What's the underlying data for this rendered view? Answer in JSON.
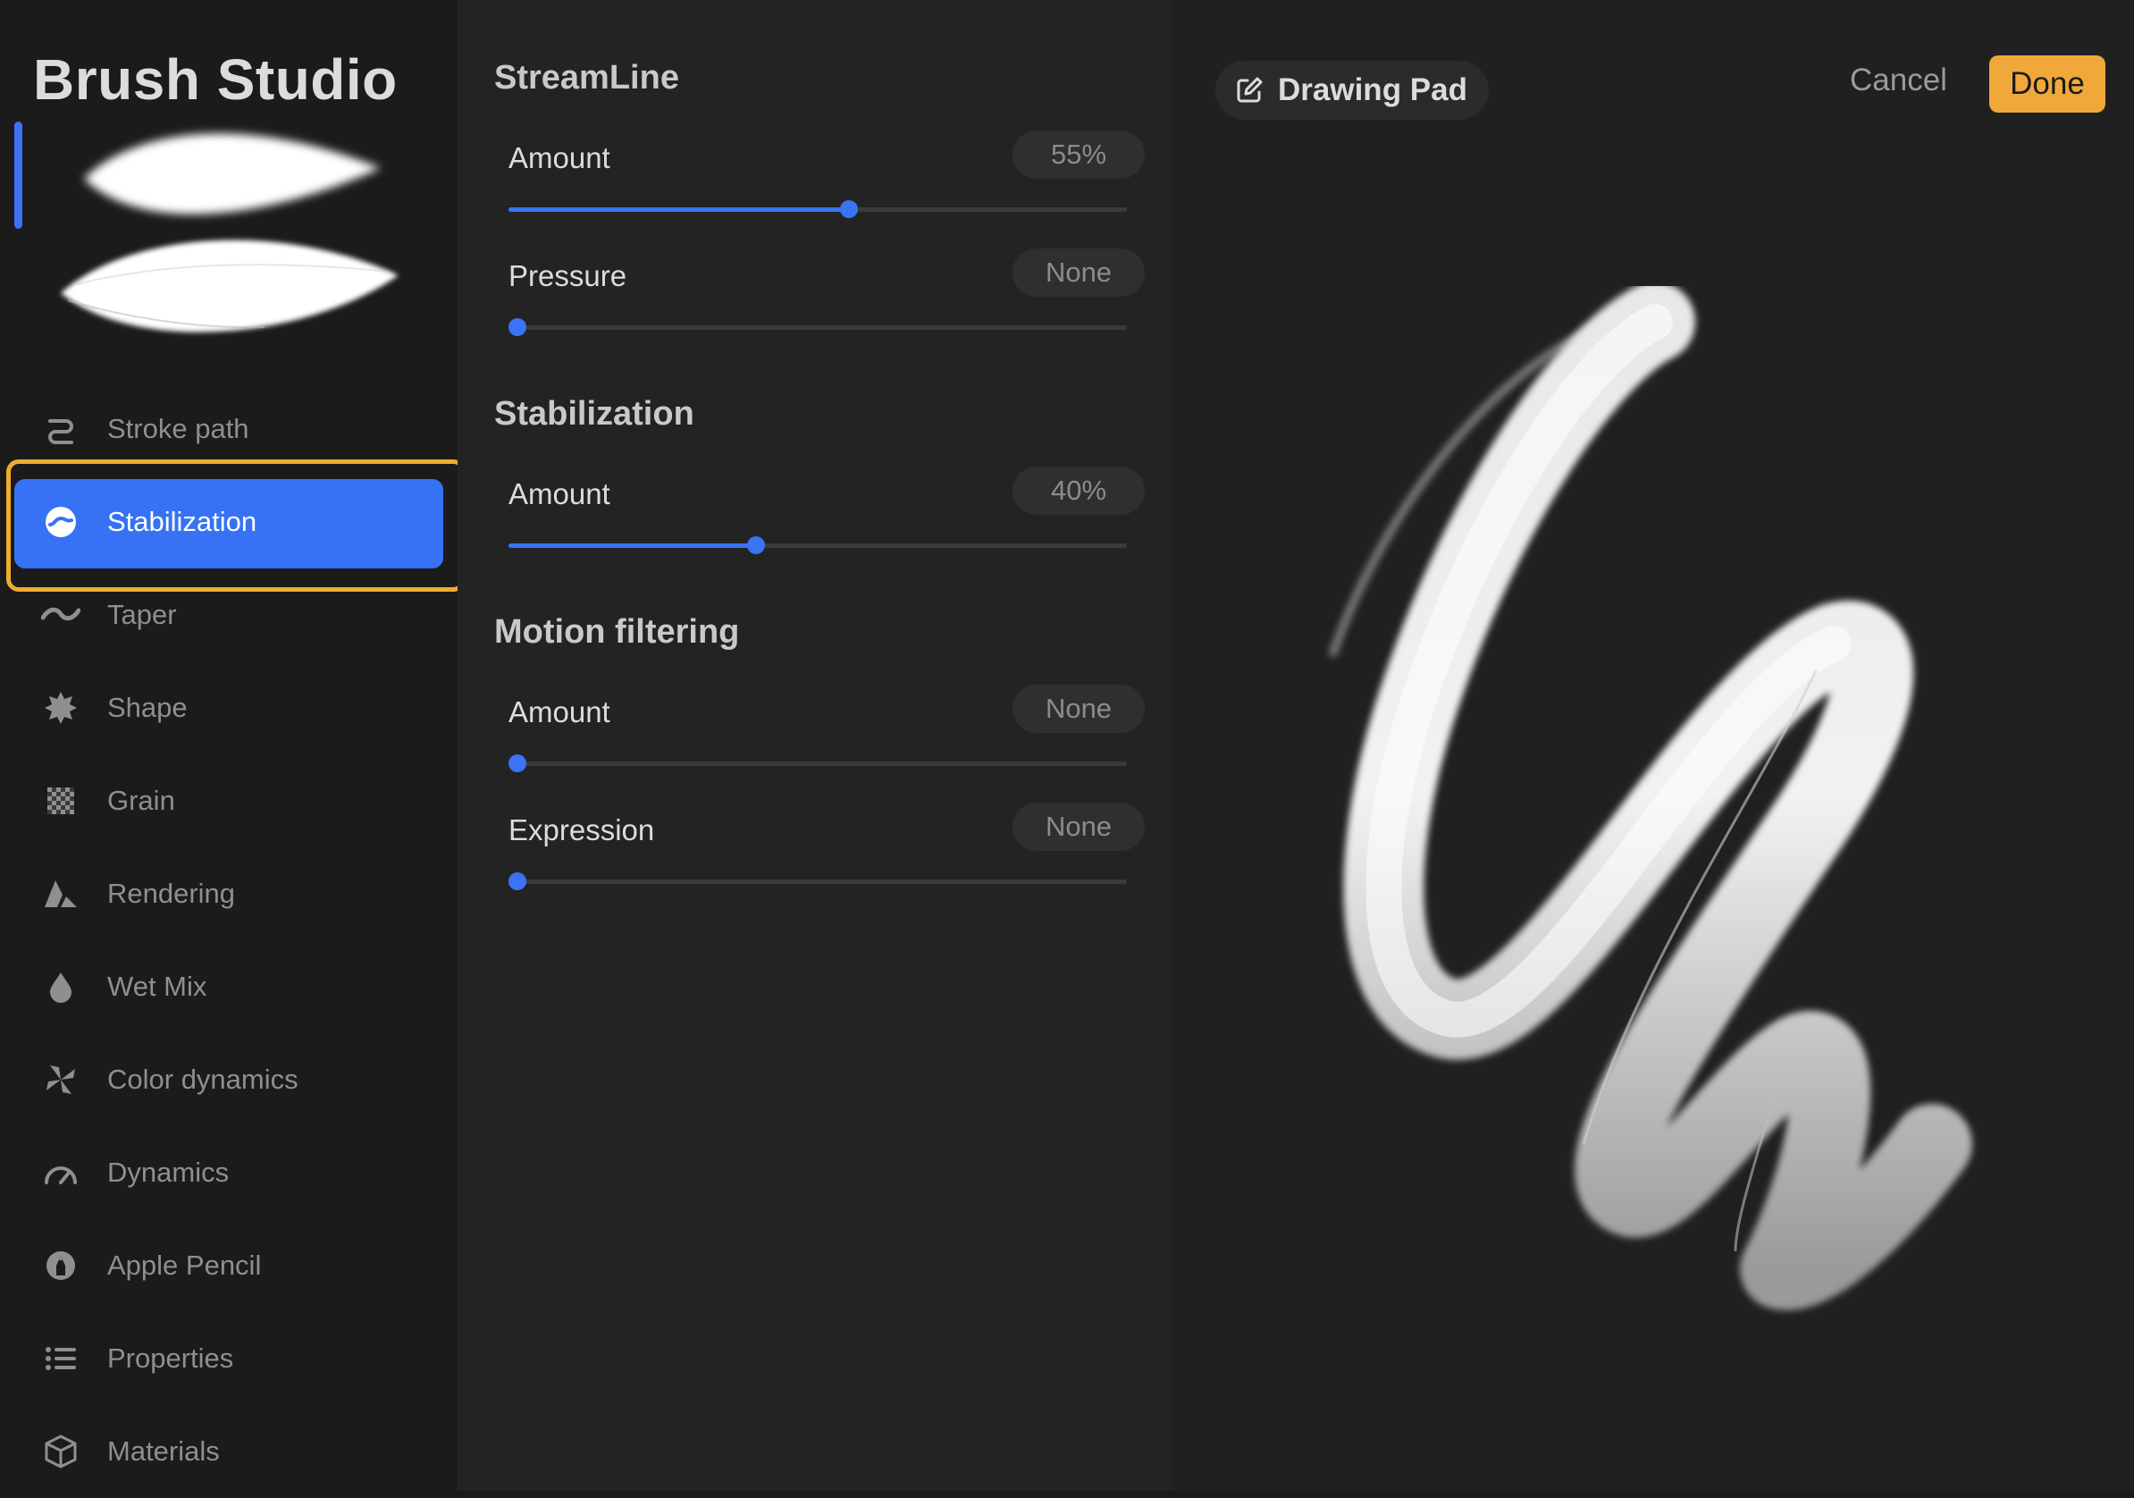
{
  "app": {
    "title": "Brush Studio"
  },
  "sidebar": {
    "items": [
      {
        "label": "Stroke path",
        "icon": "stroke-path-icon",
        "active": false
      },
      {
        "label": "Stabilization",
        "icon": "stabilization-icon",
        "active": true
      },
      {
        "label": "Taper",
        "icon": "taper-icon",
        "active": false
      },
      {
        "label": "Shape",
        "icon": "shape-icon",
        "active": false
      },
      {
        "label": "Grain",
        "icon": "grain-icon",
        "active": false
      },
      {
        "label": "Rendering",
        "icon": "rendering-icon",
        "active": false
      },
      {
        "label": "Wet Mix",
        "icon": "droplet-icon",
        "active": false
      },
      {
        "label": "Color dynamics",
        "icon": "color-dynamics-icon",
        "active": false
      },
      {
        "label": "Dynamics",
        "icon": "gauge-icon",
        "active": false
      },
      {
        "label": "Apple Pencil",
        "icon": "pencil-icon",
        "active": false
      },
      {
        "label": "Properties",
        "icon": "list-icon",
        "active": false
      },
      {
        "label": "Materials",
        "icon": "cube-icon",
        "active": false
      }
    ]
  },
  "settings": {
    "streamline": {
      "title": "StreamLine",
      "amount": {
        "label": "Amount",
        "value": "55%",
        "level": 0.55
      },
      "pressure": {
        "label": "Pressure",
        "value": "None",
        "level": 0
      }
    },
    "stabilization": {
      "title": "Stabilization",
      "amount": {
        "label": "Amount",
        "value": "40%",
        "level": 0.4
      }
    },
    "motion_filtering": {
      "title": "Motion filtering",
      "amount": {
        "label": "Amount",
        "value": "None",
        "level": 0
      },
      "expression": {
        "label": "Expression",
        "value": "None",
        "level": 0
      }
    }
  },
  "pad": {
    "title": "Drawing Pad",
    "cancel_label": "Cancel",
    "done_label": "Done"
  },
  "colors": {
    "accent_blue": "#3672f3",
    "done_orange": "#f0a83a",
    "highlight_frame": "#f0ac2c"
  }
}
